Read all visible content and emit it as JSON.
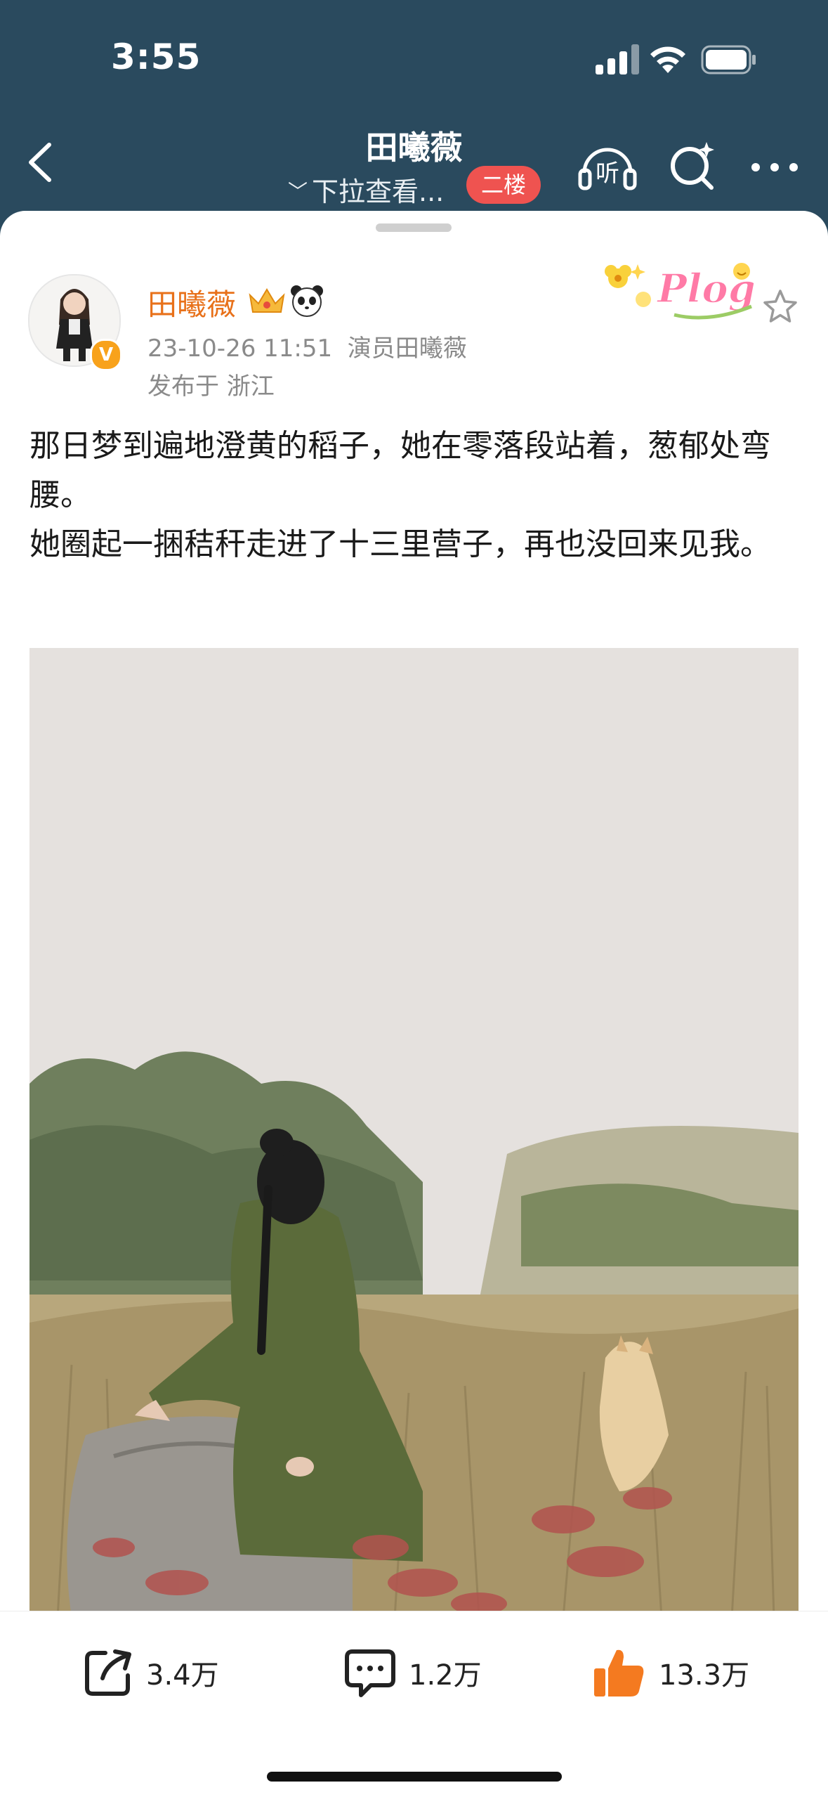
{
  "status": {
    "time": "3:55"
  },
  "nav": {
    "title": "田曦薇",
    "subtitle": "下拉查看...",
    "badge": "二楼",
    "listen_label": "听"
  },
  "post": {
    "username": "田曦薇",
    "timestamp": "23-10-26 11:51",
    "source": "演员田曦薇",
    "location": "发布于 浙江",
    "badge_text": "Plog",
    "verified_mark": "V",
    "text_lines": [
      "那日梦到遍地澄黄的稻子，她在零落段站着，葱郁处弯腰。",
      "她圈起一捆秸秆走进了十三里营子，再也没回来见我。"
    ]
  },
  "actions": {
    "share_count": "3.4万",
    "comment_count": "1.2万",
    "like_count": "13.3万"
  },
  "colors": {
    "header_bg": "#2a4a5e",
    "username": "#e8711a",
    "badge_red": "#ef5350",
    "like_orange": "#f47a20"
  }
}
